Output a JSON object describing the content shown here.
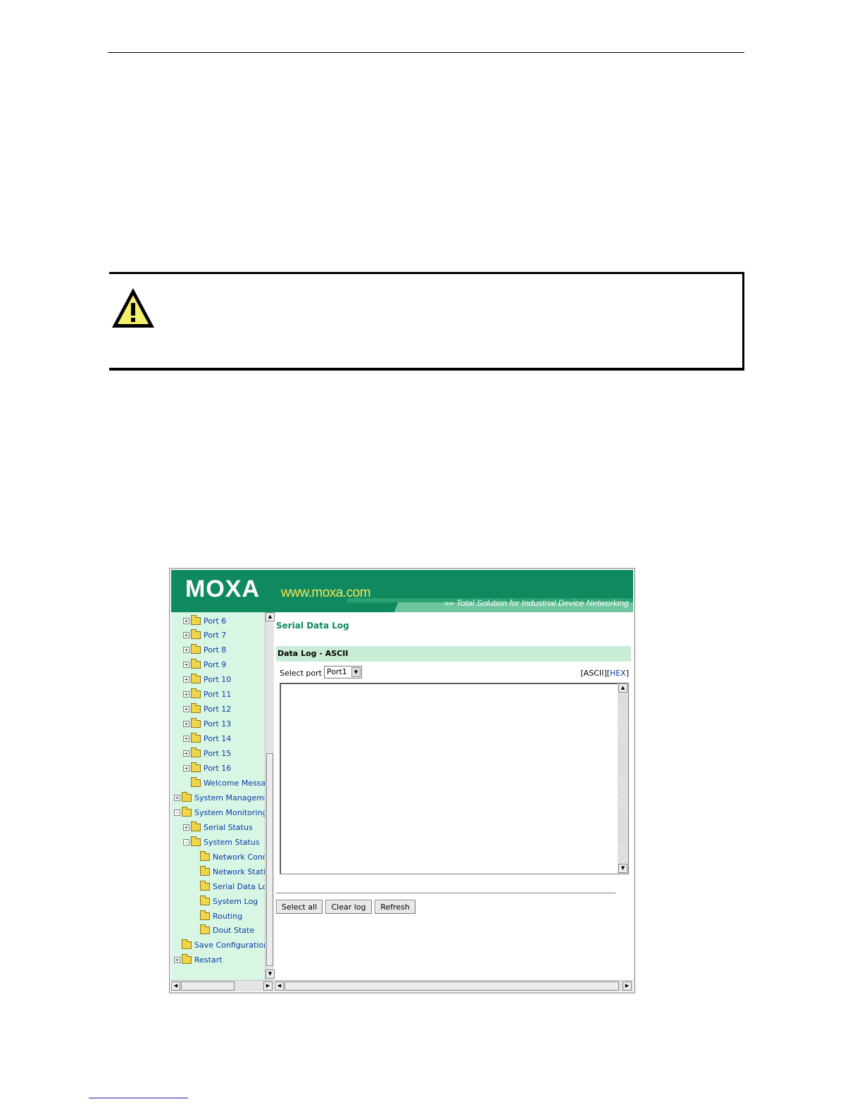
{
  "header": {
    "logo_text": "MOXA",
    "site_url": "www.moxa.com",
    "tagline": "Total Solution for Industrial Device Networking"
  },
  "nav": {
    "items": [
      {
        "label": "Port 6",
        "toggle": "+"
      },
      {
        "label": "Port 7",
        "toggle": "+"
      },
      {
        "label": "Port 8",
        "toggle": "+"
      },
      {
        "label": "Port 9",
        "toggle": "+"
      },
      {
        "label": "Port 10",
        "toggle": "+"
      },
      {
        "label": "Port 11",
        "toggle": "+"
      },
      {
        "label": "Port 12",
        "toggle": "+"
      },
      {
        "label": "Port 13",
        "toggle": "+"
      },
      {
        "label": "Port 14",
        "toggle": "+"
      },
      {
        "label": "Port 15",
        "toggle": "+"
      },
      {
        "label": "Port 16",
        "toggle": "+"
      },
      {
        "label": "Welcome Messag",
        "toggle": ""
      },
      {
        "label": "System Managemer",
        "toggle": "+"
      },
      {
        "label": "System Monitoring",
        "toggle": "-"
      },
      {
        "label": "Serial Status",
        "toggle": "+"
      },
      {
        "label": "System Status",
        "toggle": "-"
      },
      {
        "label": "Network Conne",
        "toggle": ""
      },
      {
        "label": "Network Statis",
        "toggle": ""
      },
      {
        "label": "Serial Data Log",
        "toggle": ""
      },
      {
        "label": "System Log",
        "toggle": ""
      },
      {
        "label": "Routing",
        "toggle": ""
      },
      {
        "label": "Dout State",
        "toggle": ""
      },
      {
        "label": "Save Configuration",
        "toggle": ""
      },
      {
        "label": "Restart",
        "toggle": "+"
      }
    ]
  },
  "main": {
    "page_title": "Serial Data Log",
    "section_title": "Data Log - ASCII",
    "select_label": "Select port",
    "select_value": "Port1",
    "mode_ascii": "[ASCII]",
    "mode_hex_open": "[",
    "mode_hex": "HEX",
    "mode_hex_close": "]",
    "log_text": "",
    "buttons": {
      "select_all": "Select all",
      "clear_log": "Clear log",
      "refresh": "Refresh"
    }
  },
  "colors": {
    "banner_green": "#0f8a5e",
    "nav_bg": "#d8f6e4",
    "link_blue": "#0b3aa8",
    "site_yellow": "#f3e55a"
  },
  "icons": [
    "caution-icon",
    "folder-icon",
    "expand-toggle-icon",
    "scroll-arrow-icon",
    "dropdown-arrow-icon"
  ]
}
